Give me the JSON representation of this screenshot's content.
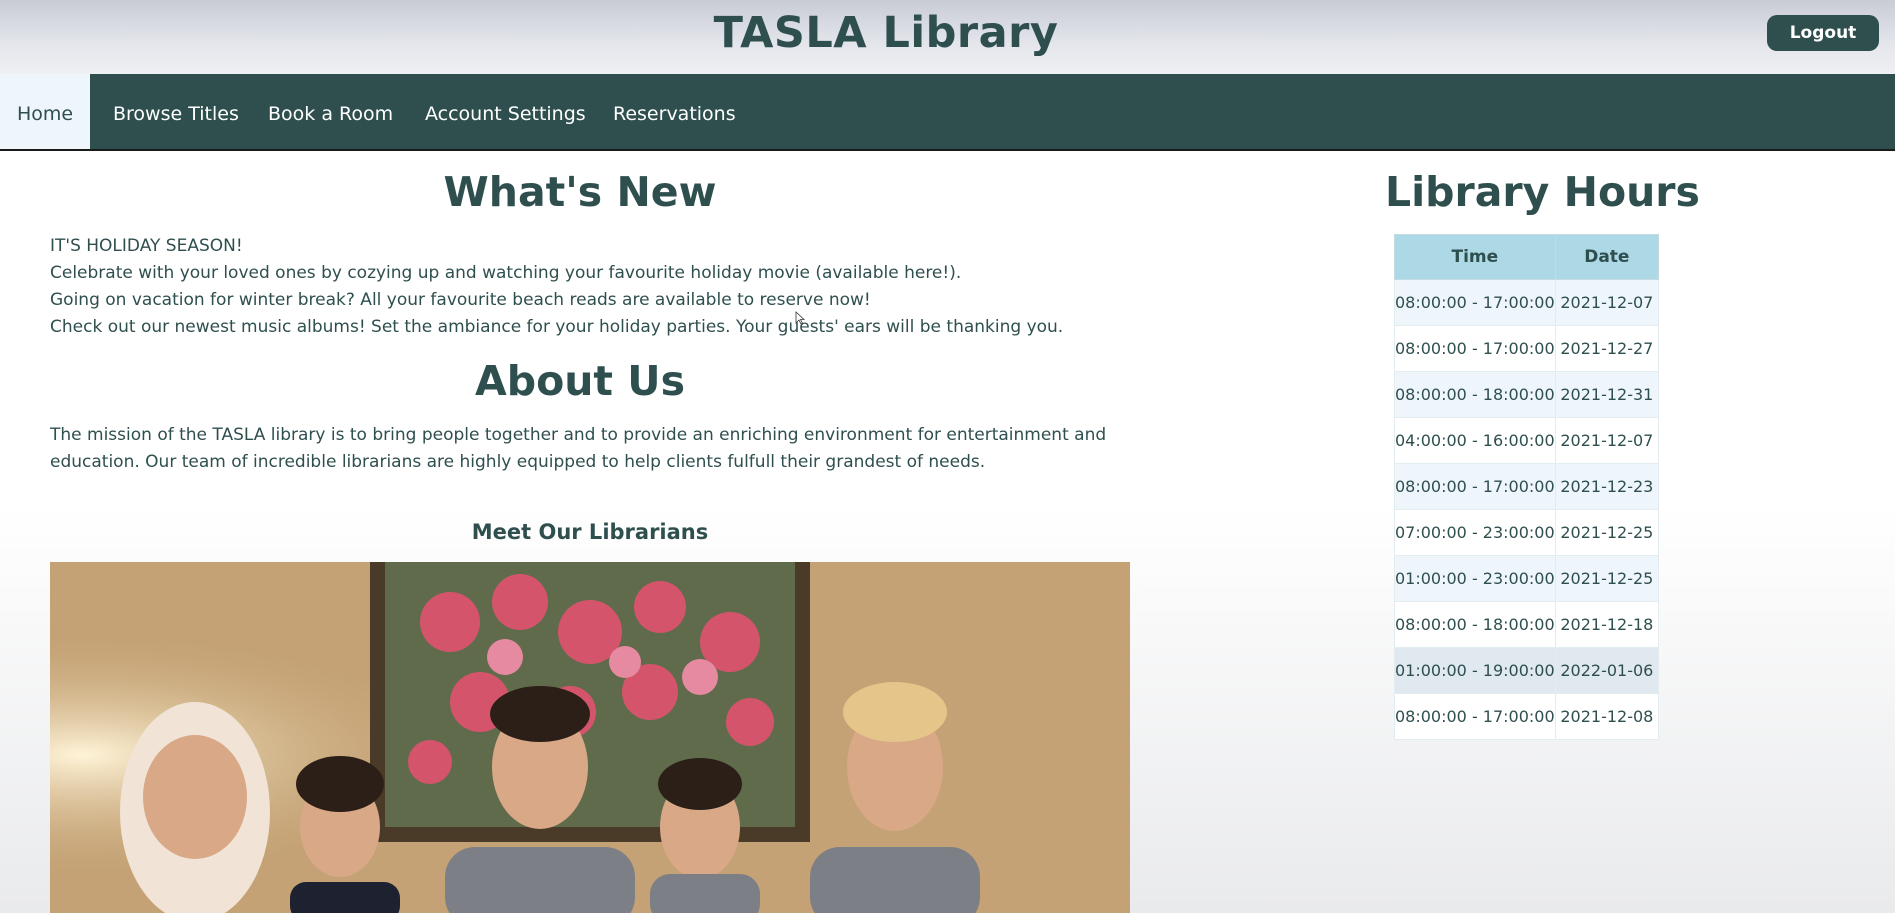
{
  "header": {
    "title": "TASLA Library",
    "logout_label": "Logout"
  },
  "nav": {
    "items": [
      {
        "label": "Home",
        "active": true
      },
      {
        "label": "Browse Titles"
      },
      {
        "label": "Book a Room"
      },
      {
        "label": "Account Settings"
      },
      {
        "label": "Reservations"
      }
    ]
  },
  "whats_new": {
    "heading": "What's New",
    "lines": [
      "IT'S HOLIDAY SEASON!",
      "Celebrate with your loved ones by cozying up and watching your favourite holiday movie (available here!).",
      "Going on vacation for winter break? All your favourite beach reads are available to reserve now!",
      "Check out our newest music albums! Set the ambiance for your holiday parties. Your guests' ears will be thanking you."
    ]
  },
  "about": {
    "heading": "About Us",
    "text": "The mission of the TASLA library is to bring people together and to provide an enriching environment for entertainment and education. Our team of incredible librarians are highly equipped to help clients fulfull their grandest of needs.",
    "librarians_heading": "Meet Our Librarians"
  },
  "hours": {
    "heading": "Library Hours",
    "columns": [
      "Time",
      "Date"
    ],
    "rows": [
      {
        "time": "08:00:00 - 17:00:00",
        "date": "2021-12-07"
      },
      {
        "time": "08:00:00 - 17:00:00",
        "date": "2021-12-27"
      },
      {
        "time": "08:00:00 - 18:00:00",
        "date": "2021-12-31"
      },
      {
        "time": "04:00:00 - 16:00:00",
        "date": "2021-12-07"
      },
      {
        "time": "08:00:00 - 17:00:00",
        "date": "2021-12-23"
      },
      {
        "time": "07:00:00 - 23:00:00",
        "date": "2021-12-25"
      },
      {
        "time": "01:00:00 - 23:00:00",
        "date": "2021-12-25"
      },
      {
        "time": "08:00:00 - 18:00:00",
        "date": "2021-12-18"
      },
      {
        "time": "01:00:00 - 19:00:00",
        "date": "2022-01-06"
      },
      {
        "time": "08:00:00 - 17:00:00",
        "date": "2021-12-08"
      }
    ]
  },
  "colors": {
    "primary": "#2f4f4f",
    "table_header": "#add8e6",
    "row_stripe": "#eef6fb"
  }
}
